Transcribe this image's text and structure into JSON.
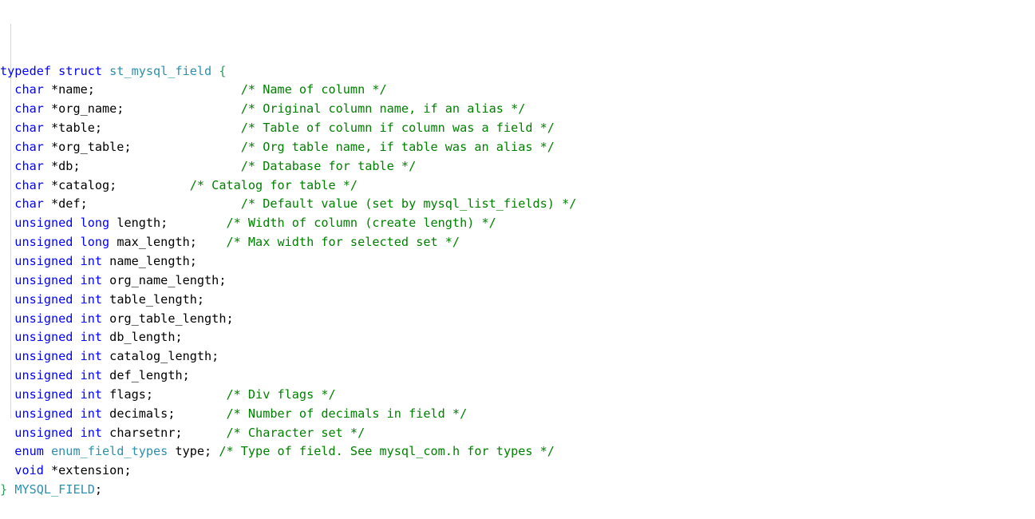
{
  "editor": {
    "language": "c",
    "colors": {
      "background": "#ffffff",
      "keyword": "#0000ff",
      "type_name": "#2b91af",
      "identifier": "#000000",
      "comment": "#008000",
      "matching_brace": "#2e9d5b",
      "indent_guide": "#d7d7d7"
    },
    "line_count": 24
  },
  "code": {
    "lines": [
      {
        "n": 1,
        "tokens": [
          {
            "t": "typedef struct ",
            "c": "kw"
          },
          {
            "t": "st_mysql_field ",
            "c": "type"
          },
          {
            "t": "{",
            "c": "brace"
          }
        ]
      },
      {
        "n": 2,
        "tokens": [
          {
            "t": "  ",
            "c": "plain"
          },
          {
            "t": "char ",
            "c": "kw"
          },
          {
            "t": "*name;",
            "c": "plain"
          },
          {
            "t": "                    ",
            "c": "plain"
          },
          {
            "t": "/* Name of column */",
            "c": "comment"
          }
        ]
      },
      {
        "n": 3,
        "tokens": [
          {
            "t": "  ",
            "c": "plain"
          },
          {
            "t": "char ",
            "c": "kw"
          },
          {
            "t": "*org_name;",
            "c": "plain"
          },
          {
            "t": "                ",
            "c": "plain"
          },
          {
            "t": "/* Original column name, if an alias */",
            "c": "comment"
          }
        ]
      },
      {
        "n": 4,
        "tokens": [
          {
            "t": "  ",
            "c": "plain"
          },
          {
            "t": "char ",
            "c": "kw"
          },
          {
            "t": "*table;",
            "c": "plain"
          },
          {
            "t": "                   ",
            "c": "plain"
          },
          {
            "t": "/* Table of column if column was a field */",
            "c": "comment"
          }
        ]
      },
      {
        "n": 5,
        "tokens": [
          {
            "t": "  ",
            "c": "plain"
          },
          {
            "t": "char ",
            "c": "kw"
          },
          {
            "t": "*org_table;",
            "c": "plain"
          },
          {
            "t": "               ",
            "c": "plain"
          },
          {
            "t": "/* Org table name, if table was an alias */",
            "c": "comment"
          }
        ]
      },
      {
        "n": 6,
        "tokens": [
          {
            "t": "  ",
            "c": "plain"
          },
          {
            "t": "char ",
            "c": "kw"
          },
          {
            "t": "*db;",
            "c": "plain"
          },
          {
            "t": "                      ",
            "c": "plain"
          },
          {
            "t": "/* Database for table */",
            "c": "comment"
          }
        ]
      },
      {
        "n": 7,
        "tokens": [
          {
            "t": "  ",
            "c": "plain"
          },
          {
            "t": "char ",
            "c": "kw"
          },
          {
            "t": "*catalog;",
            "c": "plain"
          },
          {
            "t": "          ",
            "c": "plain"
          },
          {
            "t": "/* Catalog for table */",
            "c": "comment"
          }
        ]
      },
      {
        "n": 8,
        "tokens": [
          {
            "t": "  ",
            "c": "plain"
          },
          {
            "t": "char ",
            "c": "kw"
          },
          {
            "t": "*def;",
            "c": "plain"
          },
          {
            "t": "                     ",
            "c": "plain"
          },
          {
            "t": "/* Default value (set by mysql_list_fields) */",
            "c": "comment"
          }
        ]
      },
      {
        "n": 9,
        "tokens": [
          {
            "t": "  ",
            "c": "plain"
          },
          {
            "t": "unsigned long ",
            "c": "kw"
          },
          {
            "t": "length;",
            "c": "plain"
          },
          {
            "t": "        ",
            "c": "plain"
          },
          {
            "t": "/* Width of column (create length) */",
            "c": "comment"
          }
        ]
      },
      {
        "n": 10,
        "tokens": [
          {
            "t": "  ",
            "c": "plain"
          },
          {
            "t": "unsigned long ",
            "c": "kw"
          },
          {
            "t": "max_length;",
            "c": "plain"
          },
          {
            "t": "    ",
            "c": "plain"
          },
          {
            "t": "/* Max width for selected set */",
            "c": "comment"
          }
        ]
      },
      {
        "n": 11,
        "tokens": [
          {
            "t": "  ",
            "c": "plain"
          },
          {
            "t": "unsigned int ",
            "c": "kw"
          },
          {
            "t": "name_length;",
            "c": "plain"
          }
        ]
      },
      {
        "n": 12,
        "tokens": [
          {
            "t": "  ",
            "c": "plain"
          },
          {
            "t": "unsigned int ",
            "c": "kw"
          },
          {
            "t": "org_name_length;",
            "c": "plain"
          }
        ]
      },
      {
        "n": 13,
        "tokens": [
          {
            "t": "  ",
            "c": "plain"
          },
          {
            "t": "unsigned int ",
            "c": "kw"
          },
          {
            "t": "table_length;",
            "c": "plain"
          }
        ]
      },
      {
        "n": 14,
        "tokens": [
          {
            "t": "  ",
            "c": "plain"
          },
          {
            "t": "unsigned int ",
            "c": "kw"
          },
          {
            "t": "org_table_length;",
            "c": "plain"
          }
        ]
      },
      {
        "n": 15,
        "tokens": [
          {
            "t": "  ",
            "c": "plain"
          },
          {
            "t": "unsigned int ",
            "c": "kw"
          },
          {
            "t": "db_length;",
            "c": "plain"
          }
        ]
      },
      {
        "n": 16,
        "tokens": [
          {
            "t": "  ",
            "c": "plain"
          },
          {
            "t": "unsigned int ",
            "c": "kw"
          },
          {
            "t": "catalog_length;",
            "c": "plain"
          }
        ]
      },
      {
        "n": 17,
        "tokens": [
          {
            "t": "  ",
            "c": "plain"
          },
          {
            "t": "unsigned int ",
            "c": "kw"
          },
          {
            "t": "def_length;",
            "c": "plain"
          }
        ]
      },
      {
        "n": 18,
        "tokens": [
          {
            "t": "  ",
            "c": "plain"
          },
          {
            "t": "unsigned int ",
            "c": "kw"
          },
          {
            "t": "flags;",
            "c": "plain"
          },
          {
            "t": "          ",
            "c": "plain"
          },
          {
            "t": "/* Div flags */",
            "c": "comment"
          }
        ]
      },
      {
        "n": 19,
        "tokens": [
          {
            "t": "  ",
            "c": "plain"
          },
          {
            "t": "unsigned int ",
            "c": "kw"
          },
          {
            "t": "decimals;",
            "c": "plain"
          },
          {
            "t": "       ",
            "c": "plain"
          },
          {
            "t": "/* Number of decimals in field */",
            "c": "comment"
          }
        ]
      },
      {
        "n": 20,
        "tokens": [
          {
            "t": "  ",
            "c": "plain"
          },
          {
            "t": "unsigned int ",
            "c": "kw"
          },
          {
            "t": "charsetnr;",
            "c": "plain"
          },
          {
            "t": "      ",
            "c": "plain"
          },
          {
            "t": "/* Character set */",
            "c": "comment"
          }
        ]
      },
      {
        "n": 21,
        "tokens": [
          {
            "t": "  ",
            "c": "plain"
          },
          {
            "t": "enum ",
            "c": "kw"
          },
          {
            "t": "enum_field_types ",
            "c": "type"
          },
          {
            "t": "type; ",
            "c": "plain"
          },
          {
            "t": "/* Type of field. See mysql_com.h for types */",
            "c": "comment"
          }
        ]
      },
      {
        "n": 22,
        "tokens": [
          {
            "t": "  ",
            "c": "plain"
          },
          {
            "t": "void ",
            "c": "kw"
          },
          {
            "t": "*extension;",
            "c": "plain"
          }
        ]
      },
      {
        "n": 23,
        "tokens": [
          {
            "t": "}",
            "c": "brace"
          },
          {
            "t": " ",
            "c": "plain"
          },
          {
            "t": "MYSQL_FIELD",
            "c": "type"
          },
          {
            "t": ";",
            "c": "plain"
          }
        ]
      }
    ]
  }
}
